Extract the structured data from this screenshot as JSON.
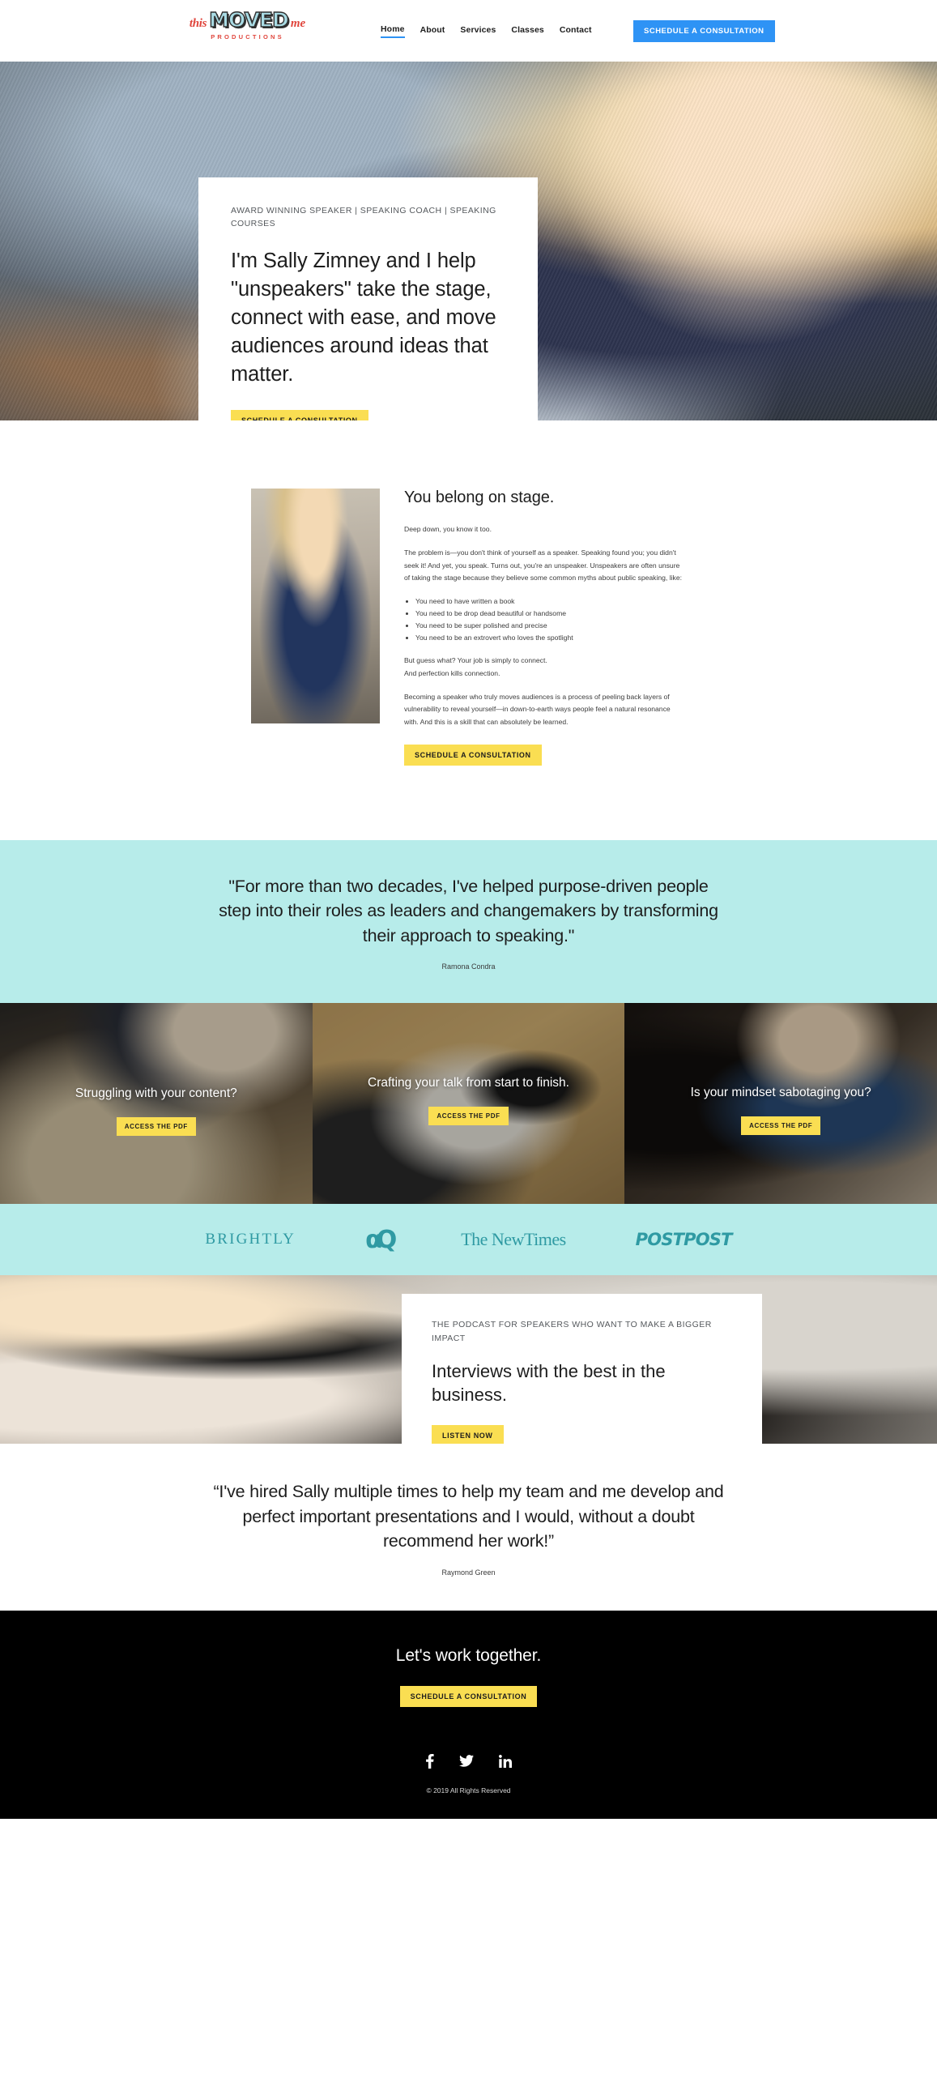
{
  "header": {
    "logo": {
      "word1": "this",
      "word2": "MOVED",
      "word3": "me",
      "tagline": "PRODUCTIONS"
    },
    "nav": [
      {
        "label": "Home",
        "active": true
      },
      {
        "label": "About",
        "active": false
      },
      {
        "label": "Services",
        "active": false
      },
      {
        "label": "Classes",
        "active": false
      },
      {
        "label": "Contact",
        "active": false
      }
    ],
    "cta_label": "SCHEDULE A CONSULTATION",
    "cta_color": "#2e93f5"
  },
  "hero": {
    "eyebrow": "AWARD WINNING SPEAKER | SPEAKING COACH | SPEAKING COURSES",
    "headline": "I'm Sally Zimney and I help \"unspeakers\" take the stage, connect with ease, and move audiences around ideas that matter.",
    "cta_label": "SCHEDULE A CONSULTATION"
  },
  "about": {
    "heading": "You belong on stage.",
    "p1": "Deep down, you know it too.",
    "p2": "The problem is—you don't think of yourself as a speaker. Speaking found you; you didn't seek it! And yet, you speak. Turns out, you're an unspeaker. Unspeakers are often unsure of taking the stage because they believe some common myths about public speaking, like:",
    "bullets": [
      "You need to have written a book",
      "You need to be drop dead beautiful or handsome",
      "You need to be super polished and precise",
      "You need to be an extrovert who loves the spotlight"
    ],
    "p3": "But guess what? Your job is simply to connect.",
    "p4": "And perfection kills connection.",
    "p5": "Becoming a speaker who truly moves audiences is a process of peeling back layers of vulnerability to reveal yourself—in down-to-earth ways people feel a natural resonance with. And this is a skill that can absolutely be learned.",
    "cta_label": "SCHEDULE A CONSULTATION"
  },
  "quote_teal": {
    "body": "\"For more than two decades, I've helped purpose-driven people step into their roles as leaders and changemakers by transforming their approach to speaking.\"",
    "attribution": "Ramona Condra",
    "background": "#b7ecea"
  },
  "cards": [
    {
      "title": "Struggling with your content?",
      "cta_label": "ACCESS THE PDF"
    },
    {
      "title": "Crafting your talk from start to finish.",
      "cta_label": "ACCESS THE PDF"
    },
    {
      "title": "Is your mindset sabotaging you?",
      "cta_label": "ACCESS THE PDF"
    }
  ],
  "logobar": {
    "background": "#b7ecea",
    "color": "#2f9aa3",
    "logos": [
      {
        "name": "brightly-logo",
        "text": "BRIGHTLY"
      },
      {
        "name": "cq-logo",
        "text": "αQ"
      },
      {
        "name": "the-new-times-logo",
        "text": "The NewTimes"
      },
      {
        "name": "postpost-logo",
        "text": "POSTPOST"
      }
    ]
  },
  "podcast": {
    "eyebrow": "THE PODCAST FOR SPEAKERS WHO WANT TO MAKE A BIGGER IMPACT",
    "heading": "Interviews with the best in the business.",
    "cta_label": "LISTEN NOW"
  },
  "quote_white": {
    "body": "“I've hired Sally multiple times to help my team and me develop and perfect important presentations and I would, without a doubt recommend her work!”",
    "attribution": "Raymond Green"
  },
  "footer": {
    "heading": "Let's work together.",
    "cta_label": "SCHEDULE A CONSULTATION",
    "socials": [
      {
        "name": "facebook-icon",
        "label": "f"
      },
      {
        "name": "twitter-icon",
        "label": "t"
      },
      {
        "name": "linkedin-icon",
        "label": "in"
      }
    ],
    "copyright": "© 2019 All Rights Reserved",
    "background": "#000000"
  },
  "accent_colors": {
    "yellow": "#fade52",
    "blue": "#2e93f5",
    "teal": "#b7ecea",
    "red": "#e0453c"
  }
}
